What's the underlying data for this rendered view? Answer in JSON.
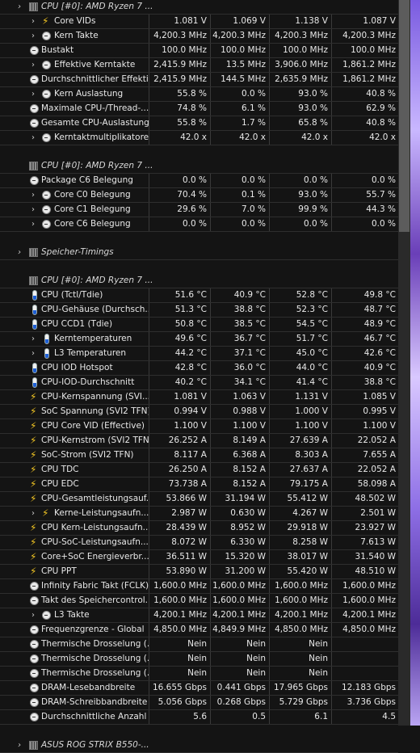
{
  "rows": [
    {
      "kind": "section",
      "label": "CPU [#0]: AMD Ryzen 7 ...",
      "chevron": true,
      "icon": "chip"
    },
    {
      "label": "Core VIDs",
      "chevron": true,
      "icon": "bolt",
      "indent": 1,
      "v": [
        "1.081 V",
        "1.069 V",
        "1.138 V",
        "1.087 V"
      ]
    },
    {
      "label": "Kern Takte",
      "chevron": true,
      "icon": "clock",
      "indent": 1,
      "v": [
        "4,200.3 MHz",
        "4,200.3 MHz",
        "4,200.3 MHz",
        "4,200.3 MHz"
      ]
    },
    {
      "label": "Bustakt",
      "icon": "clock",
      "v": [
        "100.0 MHz",
        "100.0 MHz",
        "100.0 MHz",
        "100.0 MHz"
      ]
    },
    {
      "label": "Effektive Kerntakte",
      "chevron": true,
      "icon": "clock",
      "indent": 1,
      "v": [
        "2,415.9 MHz",
        "13.5 MHz",
        "3,906.0 MHz",
        "1,861.2 MHz"
      ]
    },
    {
      "label": "Durchschnittlicher Effekti...",
      "icon": "clock",
      "v": [
        "2,415.9 MHz",
        "144.5 MHz",
        "2,635.9 MHz",
        "1,861.2 MHz"
      ]
    },
    {
      "label": "Kern Auslastung",
      "chevron": true,
      "icon": "clock",
      "indent": 1,
      "v": [
        "55.8 %",
        "0.0 %",
        "93.0 %",
        "40.8 %"
      ]
    },
    {
      "label": "Maximale CPU-/Thread-...",
      "icon": "clock",
      "v": [
        "74.8 %",
        "6.1 %",
        "93.0 %",
        "62.9 %"
      ]
    },
    {
      "label": "Gesamte CPU-Auslastung",
      "icon": "clock",
      "v": [
        "55.8 %",
        "1.7 %",
        "65.8 %",
        "40.8 %"
      ]
    },
    {
      "label": "Kerntaktmultiplikatoren",
      "chevron": true,
      "icon": "clock",
      "indent": 1,
      "v": [
        "42.0 x",
        "42.0 x",
        "42.0 x",
        "42.0 x"
      ]
    },
    {
      "kind": "blank"
    },
    {
      "kind": "section",
      "label": "CPU [#0]: AMD Ryzen 7 ...",
      "chevron": false,
      "icon": "chip"
    },
    {
      "label": "Package C6 Belegung",
      "icon": "clock",
      "v": [
        "0.0 %",
        "0.0 %",
        "0.0 %",
        "0.0 %"
      ]
    },
    {
      "label": "Core C0 Belegung",
      "chevron": true,
      "icon": "clock",
      "indent": 1,
      "v": [
        "70.4 %",
        "0.1 %",
        "93.0 %",
        "55.7 %"
      ]
    },
    {
      "label": "Core C1 Belegung",
      "chevron": true,
      "icon": "clock",
      "indent": 1,
      "v": [
        "29.6 %",
        "7.0 %",
        "99.9 %",
        "44.3 %"
      ]
    },
    {
      "label": "Core C6 Belegung",
      "chevron": true,
      "icon": "clock",
      "indent": 1,
      "v": [
        "0.0 %",
        "0.0 %",
        "0.0 %",
        "0.0 %"
      ]
    },
    {
      "kind": "blank"
    },
    {
      "kind": "section",
      "label": "Speicher-Timings",
      "chevron": true,
      "icon": "chip"
    },
    {
      "kind": "blank"
    },
    {
      "kind": "section",
      "label": "CPU [#0]: AMD Ryzen 7 ...",
      "chevron": false,
      "icon": "chip"
    },
    {
      "label": "CPU (Tctl/Tdie)",
      "icon": "temp",
      "v": [
        "51.6 °C",
        "40.9 °C",
        "52.8 °C",
        "49.8 °C"
      ]
    },
    {
      "label": "CPU-Gehäuse (Durchsch...",
      "icon": "temp",
      "v": [
        "51.3 °C",
        "38.8 °C",
        "52.3 °C",
        "48.7 °C"
      ]
    },
    {
      "label": "CPU CCD1 (Tdie)",
      "icon": "temp",
      "v": [
        "50.8 °C",
        "38.5 °C",
        "54.5 °C",
        "48.9 °C"
      ]
    },
    {
      "label": "Kerntemperaturen",
      "chevron": true,
      "icon": "temp",
      "indent": 1,
      "v": [
        "49.6 °C",
        "36.7 °C",
        "51.7 °C",
        "46.7 °C"
      ]
    },
    {
      "label": "L3 Temperaturen",
      "chevron": true,
      "icon": "temp",
      "indent": 1,
      "v": [
        "44.2 °C",
        "37.1 °C",
        "45.0 °C",
        "42.6 °C"
      ]
    },
    {
      "label": "CPU IOD Hotspot",
      "icon": "temp",
      "v": [
        "42.8 °C",
        "36.0 °C",
        "44.0 °C",
        "40.9 °C"
      ]
    },
    {
      "label": "CPU-IOD-Durchschnitt",
      "icon": "temp",
      "v": [
        "40.2 °C",
        "34.1 °C",
        "41.4 °C",
        "38.8 °C"
      ]
    },
    {
      "label": "CPU-Kernspannung (SVI...",
      "icon": "bolt",
      "v": [
        "1.081 V",
        "1.063 V",
        "1.131 V",
        "1.085 V"
      ]
    },
    {
      "label": "SoC Spannung (SVI2 TFN)",
      "icon": "bolt",
      "v": [
        "0.994 V",
        "0.988 V",
        "1.000 V",
        "0.995 V"
      ]
    },
    {
      "label": "CPU Core VID (Effective)",
      "icon": "bolt",
      "v": [
        "1.100 V",
        "1.100 V",
        "1.100 V",
        "1.100 V"
      ]
    },
    {
      "label": "CPU-Kernstrom (SVI2 TFN)",
      "icon": "bolt",
      "v": [
        "26.252 A",
        "8.149 A",
        "27.639 A",
        "22.052 A"
      ]
    },
    {
      "label": "SoC-Strom (SVI2 TFN)",
      "icon": "bolt",
      "v": [
        "8.117 A",
        "6.368 A",
        "8.303 A",
        "7.655 A"
      ]
    },
    {
      "label": "CPU TDC",
      "icon": "bolt",
      "v": [
        "26.250 A",
        "8.152 A",
        "27.637 A",
        "22.052 A"
      ]
    },
    {
      "label": "CPU EDC",
      "icon": "bolt",
      "v": [
        "73.738 A",
        "8.152 A",
        "79.175 A",
        "58.098 A"
      ]
    },
    {
      "label": "CPU-Gesamtleistungsauf...",
      "icon": "bolt",
      "v": [
        "53.866 W",
        "31.194 W",
        "55.412 W",
        "48.502 W"
      ]
    },
    {
      "label": "Kerne-Leistungsaufn...",
      "chevron": true,
      "icon": "bolt",
      "indent": 1,
      "v": [
        "2.987 W",
        "0.630 W",
        "4.267 W",
        "2.501 W"
      ]
    },
    {
      "label": "CPU Kern-Leistungsaufn...",
      "icon": "bolt",
      "v": [
        "28.439 W",
        "8.952 W",
        "29.918 W",
        "23.927 W"
      ]
    },
    {
      "label": "CPU-SoC-Leistungsaufn...",
      "icon": "bolt",
      "v": [
        "8.072 W",
        "6.330 W",
        "8.258 W",
        "7.613 W"
      ]
    },
    {
      "label": "Core+SoC Energieverbr...",
      "icon": "bolt",
      "v": [
        "36.511 W",
        "15.320 W",
        "38.017 W",
        "31.540 W"
      ]
    },
    {
      "label": "CPU PPT",
      "icon": "bolt",
      "v": [
        "53.890 W",
        "31.200 W",
        "55.420 W",
        "48.510 W"
      ]
    },
    {
      "label": "Infinity Fabric Takt (FCLK)",
      "icon": "clock",
      "v": [
        "1,600.0 MHz",
        "1,600.0 MHz",
        "1,600.0 MHz",
        "1,600.0 MHz"
      ]
    },
    {
      "label": "Takt des Speichercontrol...",
      "icon": "clock",
      "v": [
        "1,600.0 MHz",
        "1,600.0 MHz",
        "1,600.0 MHz",
        "1,600.0 MHz"
      ]
    },
    {
      "label": "L3 Takte",
      "chevron": true,
      "icon": "clock",
      "indent": 1,
      "v": [
        "4,200.1 MHz",
        "4,200.1 MHz",
        "4,200.1 MHz",
        "4,200.1 MHz"
      ]
    },
    {
      "label": "Frequenzgrenze - Global",
      "icon": "clock",
      "v": [
        "4,850.0 MHz",
        "4,849.9 MHz",
        "4,850.0 MHz",
        "4,850.0 MHz"
      ]
    },
    {
      "label": "Thermische Drosselung (...",
      "icon": "clock",
      "v": [
        "Nein",
        "Nein",
        "Nein",
        ""
      ]
    },
    {
      "label": "Thermische Drosselung (...",
      "icon": "clock",
      "v": [
        "Nein",
        "Nein",
        "Nein",
        ""
      ]
    },
    {
      "label": "Thermische Drosselung (...",
      "icon": "clock",
      "v": [
        "Nein",
        "Nein",
        "Nein",
        ""
      ]
    },
    {
      "label": "DRAM-Lesebandbreite",
      "icon": "clock",
      "v": [
        "16.655 Gbps",
        "0.441 Gbps",
        "17.965 Gbps",
        "12.183 Gbps"
      ]
    },
    {
      "label": "DRAM-Schreibbandbreite",
      "icon": "clock",
      "v": [
        "5.056 Gbps",
        "0.268 Gbps",
        "5.729 Gbps",
        "3.736 Gbps"
      ]
    },
    {
      "label": "Durchschnittliche Anzahl ...",
      "icon": "clock",
      "v": [
        "5.6",
        "0.5",
        "6.1",
        "4.5"
      ]
    },
    {
      "kind": "blank"
    },
    {
      "kind": "section",
      "label": "ASUS ROG STRIX B550-...",
      "chevron": true,
      "icon": "chip"
    }
  ],
  "scroll_fraction": 0.32
}
